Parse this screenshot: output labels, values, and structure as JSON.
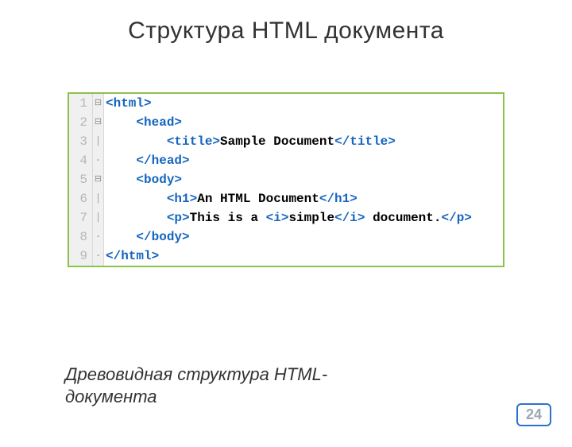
{
  "title": "Структура HTML документа",
  "caption": "Древовидная структура HTML-документа",
  "pageNumber": "24",
  "code": {
    "lines": [
      {
        "num": "1",
        "fold": "⊟",
        "segments": [
          {
            "cls": "tag",
            "t": "<html>"
          }
        ]
      },
      {
        "num": "2",
        "fold": "⊟",
        "segments": [
          {
            "cls": "txt",
            "t": "    "
          },
          {
            "cls": "tag",
            "t": "<head>"
          }
        ]
      },
      {
        "num": "3",
        "fold": "│",
        "segments": [
          {
            "cls": "txt",
            "t": "        "
          },
          {
            "cls": "tag",
            "t": "<title>"
          },
          {
            "cls": "txt",
            "t": "Sample Document"
          },
          {
            "cls": "tag",
            "t": "</title>"
          }
        ]
      },
      {
        "num": "4",
        "fold": "-",
        "segments": [
          {
            "cls": "txt",
            "t": "    "
          },
          {
            "cls": "tag",
            "t": "</head>"
          }
        ]
      },
      {
        "num": "5",
        "fold": "⊟",
        "segments": [
          {
            "cls": "txt",
            "t": "    "
          },
          {
            "cls": "tag",
            "t": "<body>"
          }
        ]
      },
      {
        "num": "6",
        "fold": "│",
        "segments": [
          {
            "cls": "txt",
            "t": "        "
          },
          {
            "cls": "tag",
            "t": "<h1>"
          },
          {
            "cls": "txt",
            "t": "An HTML Document"
          },
          {
            "cls": "tag",
            "t": "</h1>"
          }
        ]
      },
      {
        "num": "7",
        "fold": "│",
        "segments": [
          {
            "cls": "txt",
            "t": "        "
          },
          {
            "cls": "tag",
            "t": "<p>"
          },
          {
            "cls": "txt",
            "t": "This is a "
          },
          {
            "cls": "tag",
            "t": "<i>"
          },
          {
            "cls": "txt",
            "t": "simple"
          },
          {
            "cls": "tag",
            "t": "</i>"
          },
          {
            "cls": "txt",
            "t": " document."
          },
          {
            "cls": "tag",
            "t": "</p>"
          }
        ]
      },
      {
        "num": "8",
        "fold": "-",
        "segments": [
          {
            "cls": "txt",
            "t": "    "
          },
          {
            "cls": "tag",
            "t": "</body>"
          }
        ]
      },
      {
        "num": "9",
        "fold": "-",
        "segments": [
          {
            "cls": "tag",
            "t": "</html>"
          }
        ]
      }
    ]
  }
}
